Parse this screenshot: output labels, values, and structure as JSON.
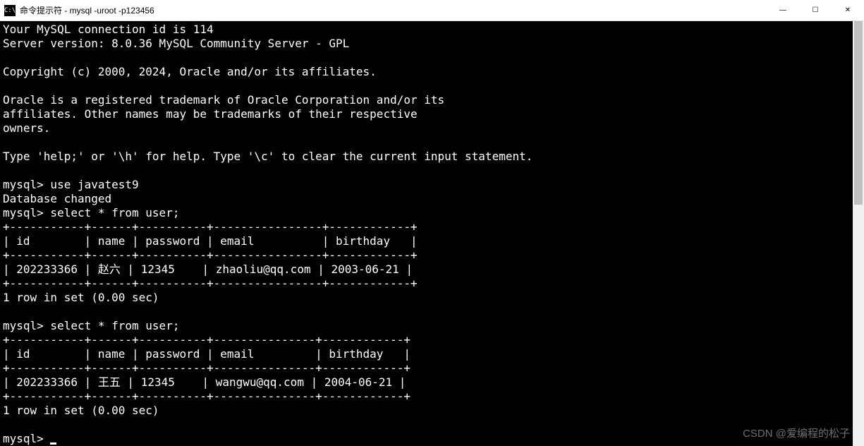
{
  "titlebar": {
    "icon_text": "C:\\",
    "title": "命令提示符 - mysql  -uroot -p123456",
    "minimize": "—",
    "maximize": "☐",
    "close": "✕"
  },
  "terminal": {
    "lines": [
      "Your MySQL connection id is 114",
      "Server version: 8.0.36 MySQL Community Server - GPL",
      "",
      "Copyright (c) 2000, 2024, Oracle and/or its affiliates.",
      "",
      "Oracle is a registered trademark of Oracle Corporation and/or its",
      "affiliates. Other names may be trademarks of their respective",
      "owners.",
      "",
      "Type 'help;' or '\\h' for help. Type '\\c' to clear the current input statement.",
      "",
      "mysql> use javatest9",
      "Database changed",
      "mysql> select * from user;",
      "+-----------+------+----------+----------------+------------+",
      "| id        | name | password | email          | birthday   |",
      "+-----------+------+----------+----------------+------------+",
      "| 202233366 | 赵六 | 12345    | zhaoliu@qq.com | 2003-06-21 |",
      "+-----------+------+----------+----------------+------------+",
      "1 row in set (0.00 sec)",
      "",
      "mysql> select * from user;",
      "+-----------+------+----------+---------------+------------+",
      "| id        | name | password | email         | birthday   |",
      "+-----------+------+----------+---------------+------------+",
      "| 202233366 | 王五 | 12345    | wangwu@qq.com | 2004-06-21 |",
      "+-----------+------+----------+---------------+------------+",
      "1 row in set (0.00 sec)",
      "",
      "mysql> "
    ]
  },
  "watermark": "CSDN @爱编程的松子"
}
